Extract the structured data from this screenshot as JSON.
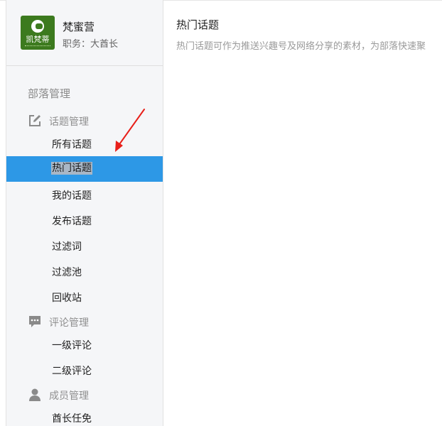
{
  "profile": {
    "name": "梵蜜营",
    "role": "职务：大酋长",
    "logo_text": "凯梵蒂"
  },
  "sidebar": {
    "section_title": "部落管理",
    "groups": [
      {
        "label": "话题管理",
        "icon": "edit-icon",
        "items": [
          {
            "label": "所有话题",
            "active": false
          },
          {
            "label": "热门话题",
            "active": true
          },
          {
            "label": "我的话题",
            "active": false
          },
          {
            "label": "发布话题",
            "active": false
          },
          {
            "label": "过滤词",
            "active": false
          },
          {
            "label": "过滤池",
            "active": false
          },
          {
            "label": "回收站",
            "active": false
          }
        ]
      },
      {
        "label": "评论管理",
        "icon": "comment-icon",
        "items": [
          {
            "label": "一级评论",
            "active": false
          },
          {
            "label": "二级评论",
            "active": false
          }
        ]
      },
      {
        "label": "成员管理",
        "icon": "user-icon",
        "items": [
          {
            "label": "酋长任免",
            "active": false
          }
        ]
      }
    ]
  },
  "main": {
    "title": "热门话题",
    "description": "热门话题可作为推送兴趣号及网络分享的素材，为部落快速聚"
  },
  "colors": {
    "active": "#2d98e6",
    "annotation_arrow": "#e8201a",
    "logo_bg": "#3c7a1e"
  }
}
